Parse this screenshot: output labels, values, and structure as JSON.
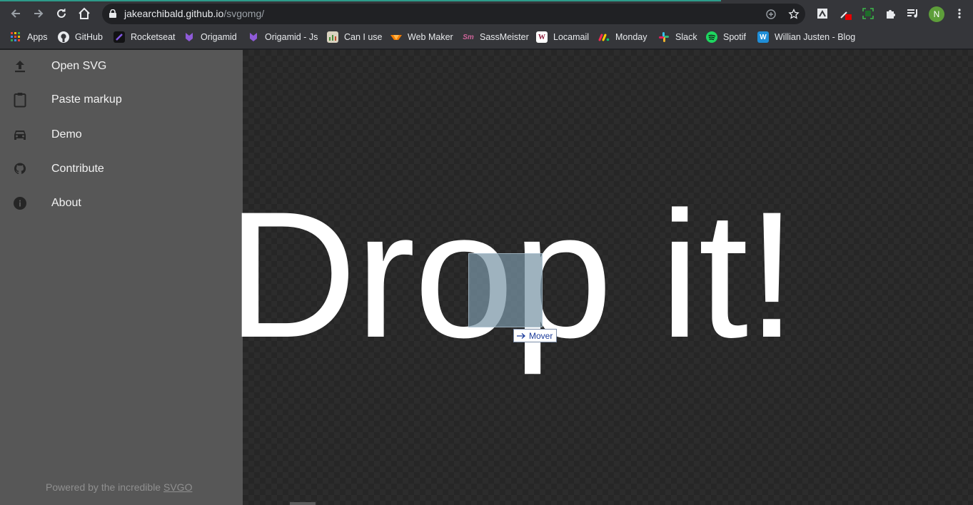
{
  "browser": {
    "url_host": "jakearchibald.github.io",
    "url_path": "/svgomg/",
    "profile_initial": "N",
    "bookmarks": [
      {
        "label": "Apps",
        "icon": "apps-grid-icon"
      },
      {
        "label": "GitHub",
        "icon": "github-icon"
      },
      {
        "label": "Rocketseat",
        "icon": "rocketseat-icon"
      },
      {
        "label": "Origamid",
        "icon": "origamid-icon"
      },
      {
        "label": "Origamid - Js",
        "icon": "origamid-icon"
      },
      {
        "label": "Can I use",
        "icon": "caniuse-icon"
      },
      {
        "label": "Web Maker",
        "icon": "webmaker-icon"
      },
      {
        "label": "SassMeister",
        "icon": "sassmeister-icon"
      },
      {
        "label": "Locamail",
        "icon": "locamail-icon"
      },
      {
        "label": "Monday",
        "icon": "monday-icon"
      },
      {
        "label": "Slack",
        "icon": "slack-icon"
      },
      {
        "label": "Spotif",
        "icon": "spotify-icon"
      },
      {
        "label": "Willian Justen - Blog",
        "icon": "w-blog-icon"
      }
    ]
  },
  "sidebar": {
    "items": [
      {
        "label": "Open SVG",
        "icon": "upload-icon"
      },
      {
        "label": "Paste markup",
        "icon": "clipboard-icon"
      },
      {
        "label": "Demo",
        "icon": "car-icon"
      },
      {
        "label": "Contribute",
        "icon": "github-icon"
      },
      {
        "label": "About",
        "icon": "info-icon"
      }
    ],
    "footer_text": "Powered by the incredible ",
    "footer_link": "SVGO"
  },
  "canvas": {
    "drop_text": "Drop it!",
    "drag_tooltip": "Mover"
  },
  "colors": {
    "sidebar_bg": "#575757",
    "canvas_bg": "#262626",
    "chrome_bg": "#35363a",
    "avatar": "#5e9e3a"
  }
}
